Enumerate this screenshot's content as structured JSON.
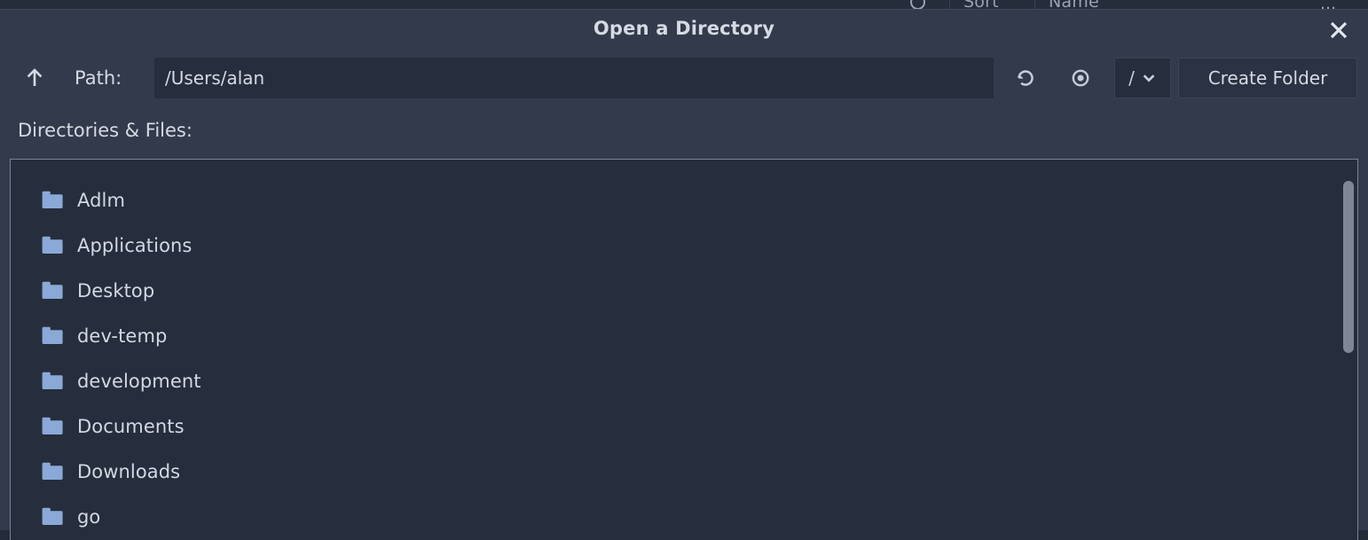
{
  "background_window": {
    "search_icon": "search-icon",
    "sort_label": "Sort",
    "name_label": "Name",
    "overflow_label": "..."
  },
  "dialog": {
    "title": "Open a Directory",
    "close_icon": "close-icon",
    "toolbar": {
      "up_icon": "arrow-up-icon",
      "path_label": "Path:",
      "path_value": "/Users/alan",
      "path_placeholder": "",
      "refresh_icon": "refresh-icon",
      "show_hidden_icon": "eye-icon",
      "root_select_value": "/",
      "root_select_chevron": "chevron-down-icon",
      "create_folder_label": "Create Folder"
    },
    "list_label": "Directories & Files:",
    "entries": [
      {
        "name": "Adlm",
        "icon": "folder-icon",
        "type": "directory"
      },
      {
        "name": "Applications",
        "icon": "folder-icon",
        "type": "directory"
      },
      {
        "name": "Desktop",
        "icon": "folder-icon",
        "type": "directory"
      },
      {
        "name": "dev-temp",
        "icon": "folder-icon",
        "type": "directory"
      },
      {
        "name": "development",
        "icon": "folder-icon",
        "type": "directory"
      },
      {
        "name": "Documents",
        "icon": "folder-icon",
        "type": "directory"
      },
      {
        "name": "Downloads",
        "icon": "folder-icon",
        "type": "directory"
      },
      {
        "name": "go",
        "icon": "folder-icon",
        "type": "directory"
      }
    ],
    "scrollbar": {
      "orientation": "vertical",
      "thumb_position_pct": 5,
      "thumb_size_pct": 45
    }
  },
  "colors": {
    "dialog_bg": "#323a4b",
    "list_bg": "#262d3c",
    "input_bg": "#262d3c",
    "text": "#d6dae3",
    "folder_icon": "#8aa9d6",
    "border": "#7a8295",
    "scrollbar_thumb": "#7f8796"
  }
}
